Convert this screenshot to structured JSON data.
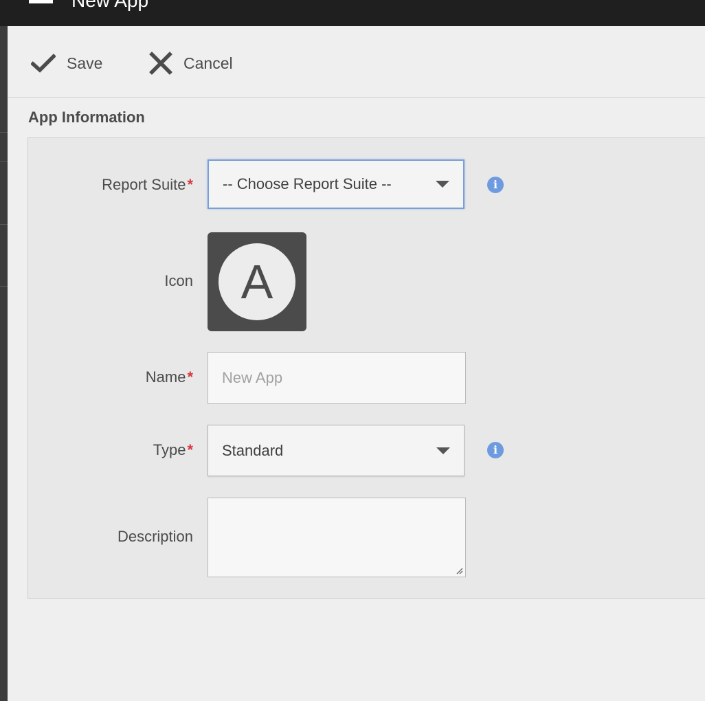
{
  "window": {
    "title": "New App"
  },
  "toolbar": {
    "save_label": "Save",
    "cancel_label": "Cancel"
  },
  "section": {
    "title": "App Information"
  },
  "form": {
    "report_suite": {
      "label": "Report Suite",
      "required": "*",
      "selected": "-- Choose Report Suite --",
      "info_icon": "info-icon"
    },
    "icon": {
      "label": "Icon",
      "letter": "A"
    },
    "name": {
      "label": "Name",
      "required": "*",
      "value": "",
      "placeholder": "New App"
    },
    "type": {
      "label": "Type",
      "required": "*",
      "selected": "Standard",
      "info_icon": "info-icon"
    },
    "description": {
      "label": "Description",
      "value": ""
    }
  },
  "colors": {
    "topbar": "#1f1f1f",
    "required": "#d7373f",
    "info": "#6e9be0",
    "focus": "#7a9fd6"
  }
}
